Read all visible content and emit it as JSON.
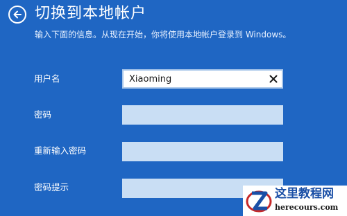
{
  "header": {
    "back_icon": "arrow-left-circle-icon",
    "title": "切换到本地帐户",
    "subtitle": "输入下面的信息。从现在开始，你将使用本地帐户登录到 Windows。"
  },
  "form": {
    "username": {
      "label": "用户名",
      "value": "Xiaoming",
      "clear_icon": "close-icon"
    },
    "password": {
      "label": "密码",
      "value": ""
    },
    "confirm_password": {
      "label": "重新输入密码",
      "value": ""
    },
    "password_hint": {
      "label": "密码提示",
      "value": ""
    }
  },
  "watermark": {
    "name": "这里教程网",
    "url": "herecours.com"
  },
  "colors": {
    "background": "#1f66c3",
    "input_inactive": "#c9def4",
    "input_active": "#ffffff",
    "watermark_text": "#1a4fa6",
    "watermark_logo_accent": "#c62828"
  }
}
